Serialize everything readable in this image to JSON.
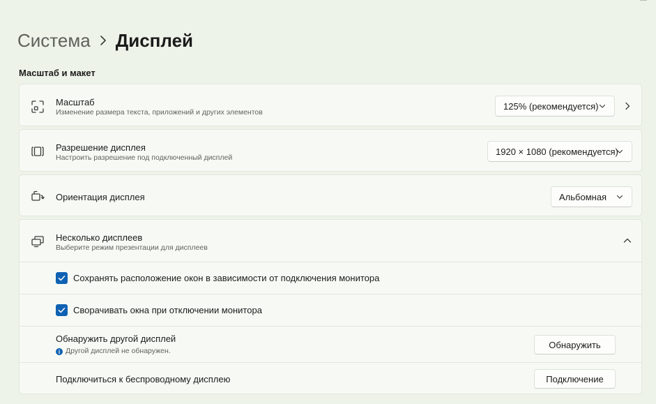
{
  "breadcrumb": {
    "parent": "Система",
    "current": "Дисплей"
  },
  "section": {
    "title": "Масштаб и макет"
  },
  "scale": {
    "title": "Масштаб",
    "subtitle": "Изменение размера текста, приложений и других элементов",
    "value": "125% (рекомендуется)",
    "icon": "scale-icon"
  },
  "resolution": {
    "title": "Разрешение дисплея",
    "subtitle": "Настроить разрешение под подключенный дисплей",
    "value": "1920 × 1080 (рекомендуется)",
    "icon": "resolution-icon"
  },
  "orientation": {
    "title": "Ориентация дисплея",
    "value": "Альбомная",
    "icon": "orientation-icon"
  },
  "multi": {
    "title": "Несколько дисплеев",
    "subtitle": "Выберите режим презентации для дисплеев",
    "icon": "multiple-displays-icon",
    "expanded": true,
    "remember_label": "Сохранять расположение окон в зависимости от подключения монитора",
    "remember_checked": true,
    "minimize_label": "Сворачивать окна при отключении монитора",
    "minimize_checked": true,
    "detect_title": "Обнаружить другой дисплей",
    "detect_status": "Другой дисплей не обнаружен.",
    "detect_button": "Обнаружить",
    "wireless_title": "Подключиться к беспроводному дисплею",
    "wireless_button": "Подключение"
  },
  "colors": {
    "accent": "#0f62b3",
    "background": "#eef3e9",
    "card": "#f7faf4"
  }
}
